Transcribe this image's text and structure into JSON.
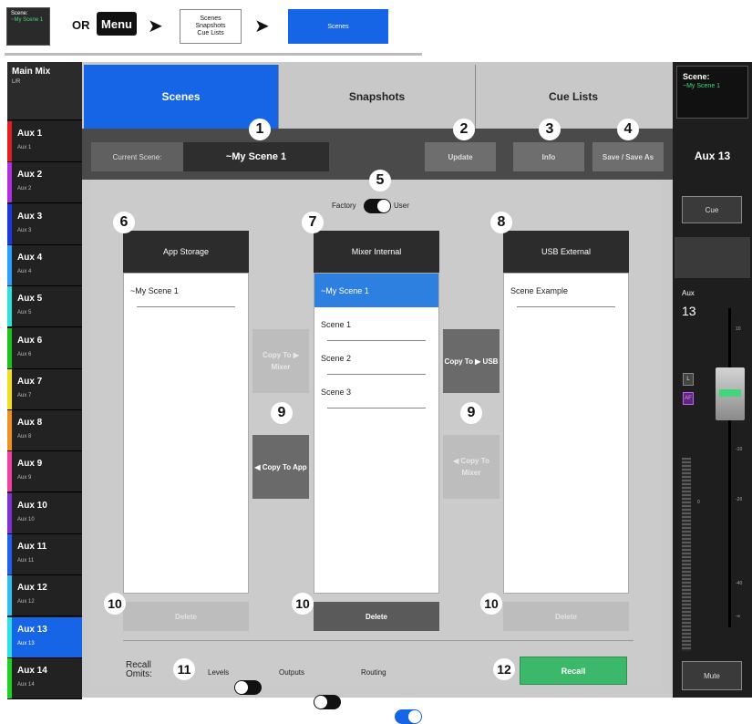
{
  "breadcrumb": {
    "thumb_title": "Scene:",
    "thumb_value": "~My Scene 1",
    "or_text": "OR",
    "menu_label": "Menu",
    "arrow1": "➤",
    "arrow2": "➤",
    "box_lines": [
      "Scenes",
      "Snapshots",
      "Cue Lists"
    ],
    "target_label": "Scenes"
  },
  "left_strip": {
    "main_title": "Main Mix",
    "main_sub": "L/R",
    "aux_items": [
      {
        "title": "Aux 1",
        "sub": "Aux 1",
        "color": "#e02020"
      },
      {
        "title": "Aux 2",
        "sub": "Aux 2",
        "color": "#b030e0"
      },
      {
        "title": "Aux 3",
        "sub": "Aux 3",
        "color": "#1a3ae0"
      },
      {
        "title": "Aux 4",
        "sub": "Aux 4",
        "color": "#2aa0ff"
      },
      {
        "title": "Aux 5",
        "sub": "Aux 5",
        "color": "#30e0e0"
      },
      {
        "title": "Aux 6",
        "sub": "Aux 6",
        "color": "#20c020"
      },
      {
        "title": "Aux 7",
        "sub": "Aux 7",
        "color": "#f0e020"
      },
      {
        "title": "Aux 8",
        "sub": "Aux 8",
        "color": "#f09020"
      },
      {
        "title": "Aux 9",
        "sub": "Aux 9",
        "color": "#f040a0"
      },
      {
        "title": "Aux 10",
        "sub": "Aux 10",
        "color": "#8030d0"
      },
      {
        "title": "Aux 11",
        "sub": "Aux 11",
        "color": "#2060f0"
      },
      {
        "title": "Aux 12",
        "sub": "Aux 12",
        "color": "#30c0f0"
      },
      {
        "title": "Aux 13",
        "sub": "Aux 13",
        "color": "#30e0e0",
        "selected": true
      },
      {
        "title": "Aux 14",
        "sub": "Aux 14",
        "color": "#20d020"
      }
    ]
  },
  "tabs": [
    "Scenes",
    "Snapshots",
    "Cue Lists"
  ],
  "current_scene": {
    "label": "Current Scene:",
    "value": "~My Scene 1"
  },
  "toolbar": {
    "update": "Update",
    "info": "Info",
    "save": "Save / Save As"
  },
  "storage_toggle": {
    "left": "Factory",
    "right": "User"
  },
  "columns": {
    "app": {
      "title": "App Storage",
      "items": [
        "~My Scene 1"
      ]
    },
    "mixer": {
      "title": "Mixer Internal",
      "items": [
        "~My Scene 1",
        "Scene 1",
        "Scene 2",
        "Scene 3"
      ]
    },
    "usb": {
      "title": "USB External",
      "items": [
        "Scene Example"
      ]
    }
  },
  "copy_buttons": {
    "to_mixer_left": "Copy To ▶ Mixer",
    "to_app": "◀ Copy To App",
    "to_usb": "Copy To ▶ USB",
    "to_mixer_right": "◀ Copy To Mixer"
  },
  "delete_label": "Delete",
  "recall_omits": {
    "label": "Recall Omits:",
    "levels": "Levels",
    "outputs": "Outputs",
    "routing": "Routing",
    "levels_on": false,
    "outputs_on": false,
    "routing_on": true
  },
  "recall_label": "Recall",
  "callouts": [
    "1",
    "2",
    "3",
    "4",
    "5",
    "6",
    "7",
    "8",
    "9",
    "9",
    "10",
    "10",
    "10",
    "11",
    "12"
  ],
  "right_strip": {
    "scene_title": "Scene:",
    "scene_value": "~My Scene 1",
    "channel": "Aux 13",
    "cue": "Cue",
    "name_top": "Aux",
    "name_num": "13",
    "l_label": "L",
    "af_label": "AF",
    "scale": [
      "10",
      "0",
      "-10",
      "-20",
      "-40",
      "-∞"
    ],
    "meter_zero": "0",
    "mute": "Mute"
  },
  "colors": {
    "accent": "#1565e6",
    "recall": "#3cb86a"
  }
}
